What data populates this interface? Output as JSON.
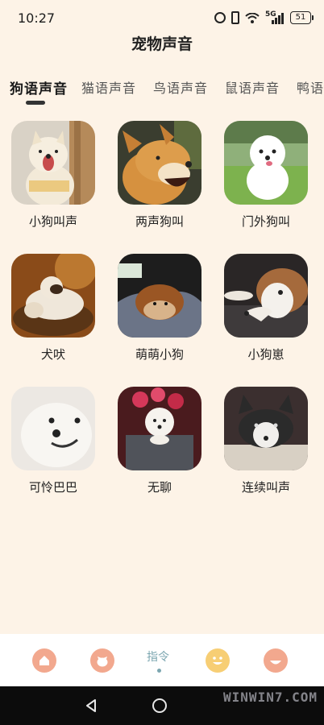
{
  "status_bar": {
    "time": "10:27",
    "network": "5G",
    "battery": "51"
  },
  "header": {
    "title": "宠物声音"
  },
  "tabs": [
    {
      "label": "狗语声音",
      "active": true
    },
    {
      "label": "猫语声音",
      "active": false
    },
    {
      "label": "鸟语声音",
      "active": false
    },
    {
      "label": "鼠语声音",
      "active": false
    },
    {
      "label": "鸭语",
      "active": false
    }
  ],
  "sounds": [
    {
      "label": "小狗叫声"
    },
    {
      "label": "两声狗叫"
    },
    {
      "label": "门外狗叫"
    },
    {
      "label": "犬吠"
    },
    {
      "label": "萌萌小狗"
    },
    {
      "label": "小狗崽"
    },
    {
      "label": "可怜巴巴"
    },
    {
      "label": "无聊"
    },
    {
      "label": "连续叫声"
    }
  ],
  "bottom_nav": {
    "items": [
      {
        "icon": "home-icon",
        "color": "#F2A88E"
      },
      {
        "icon": "cat-face-icon",
        "color": "#F2A88E"
      },
      {
        "label": "指令",
        "active": true
      },
      {
        "icon": "smile-face-icon",
        "color": "#F7CE74"
      },
      {
        "icon": "happy-face-icon",
        "color": "#F2A88E"
      }
    ]
  },
  "watermark": "WINWIN7.COM",
  "colors": {
    "background": "#FDF3E7",
    "active_text": "#1a1a1a",
    "nav_active": "#7ba6b0"
  }
}
